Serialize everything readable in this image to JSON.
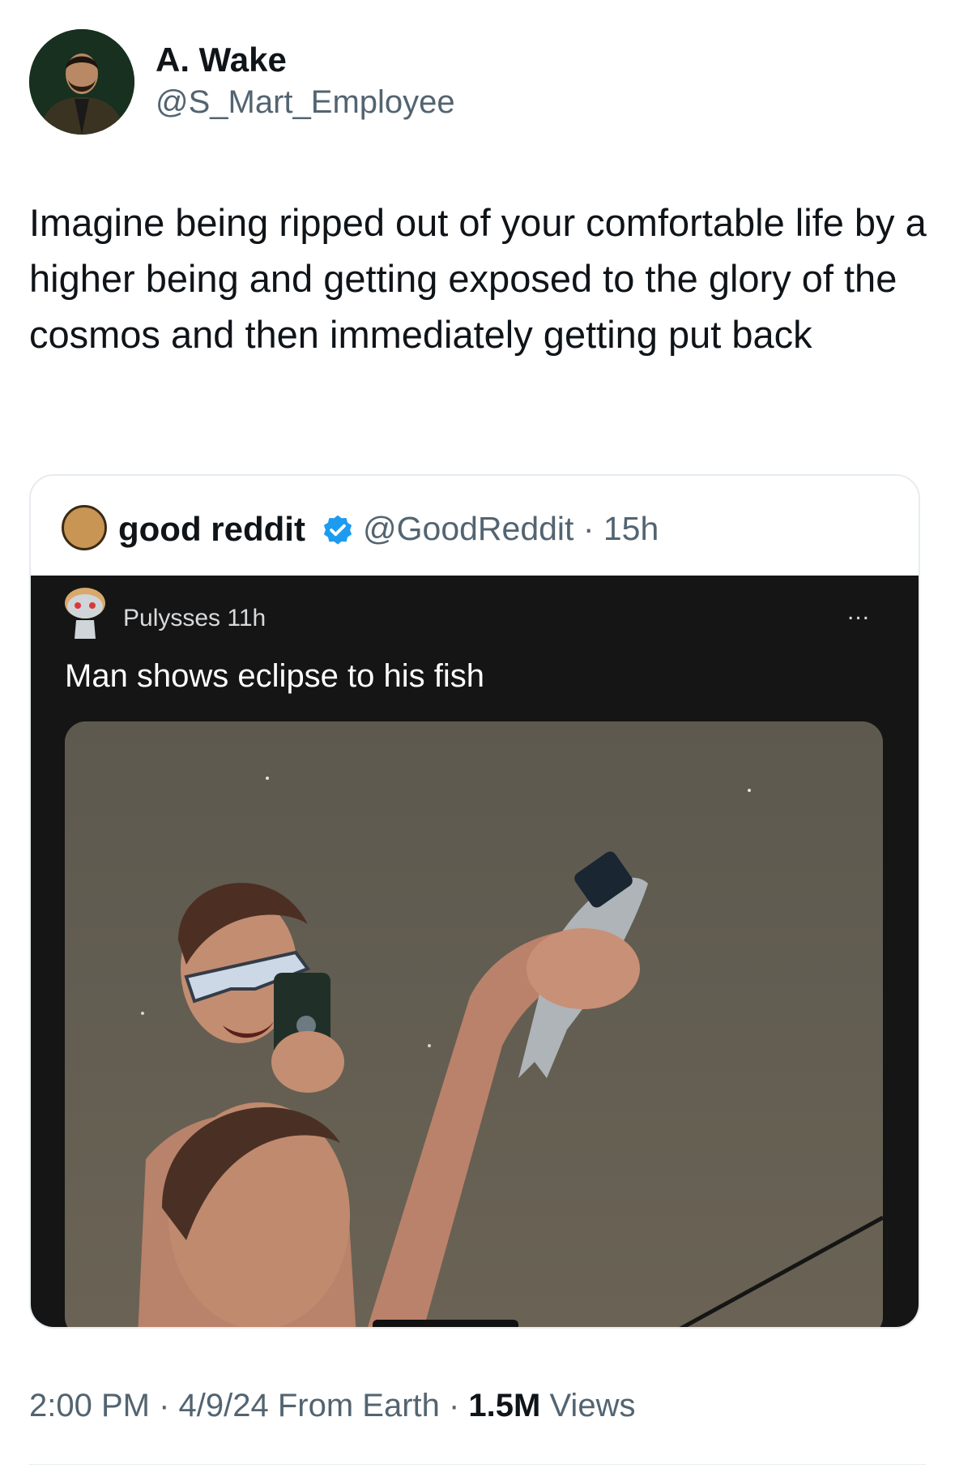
{
  "author": {
    "display_name": "A. Wake",
    "handle": "@S_Mart_Employee",
    "avatar_icon": "profile-photo"
  },
  "tweet": {
    "text": "Imagine being ripped out of your comfortable life by a higher being and getting exposed to the glory of the cosmos and then immediately getting put back"
  },
  "quoted": {
    "display_name": "good reddit",
    "verified_icon": "verified-badge-icon",
    "verified_color": "#1d9bf0",
    "handle_time": "@GoodReddit · 15h",
    "reddit_post": {
      "user_time": "Pulysses 11h",
      "more_label": "...",
      "title": "Man shows eclipse to his fish"
    }
  },
  "footer": {
    "time_date_source": "2:00 PM · 4/9/24 From Earth · ",
    "views_count": "1.5M",
    "views_label": " Views"
  }
}
